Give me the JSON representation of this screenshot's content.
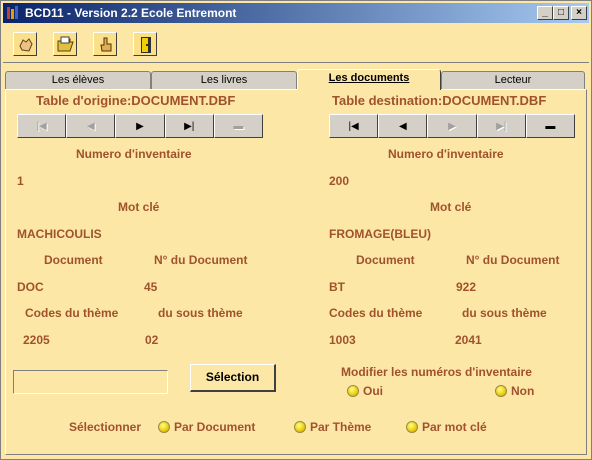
{
  "window": {
    "title": "BCD11 - Version 2.2 Ecole Entremont",
    "min": "_",
    "max": "□",
    "close": "×"
  },
  "toolbar": {
    "icons": [
      "hand-icon",
      "open-folder-icon",
      "hand-pointer-icon",
      "exit-door-icon"
    ]
  },
  "tabs": [
    "Les élèves",
    "Les livres",
    "Les documents",
    "Lecteur"
  ],
  "active_tab": "Les documents",
  "origin": {
    "table_label": "Table d'origine:DOCUMENT.DBF",
    "nav": [
      "|◀",
      "◀",
      "▶",
      "▶|",
      "▬"
    ],
    "numero_label": "Numero d'inventaire",
    "numero": "1",
    "motcle_label": "Mot clé",
    "motcle": "MACHICOULIS",
    "document_label": "Document",
    "ndoc_label": "N° du Document",
    "document": "DOC",
    "ndoc": "45",
    "theme_label": "Codes du thème",
    "soustheme_label": "du sous thème",
    "theme": "2205",
    "soustheme": "02"
  },
  "destination": {
    "table_label": "Table destination:DOCUMENT.DBF",
    "nav": [
      "|◀",
      "◀",
      "▶",
      "▶|",
      "▬"
    ],
    "numero_label": "Numero d'inventaire",
    "numero": "200",
    "motcle_label": "Mot clé",
    "motcle": "FROMAGE(BLEU)",
    "document_label": "Document",
    "ndoc_label": "N° du Document",
    "document": "BT",
    "ndoc": "922",
    "theme_label": "Codes du thème",
    "soustheme_label": "du sous thème",
    "theme": "1003",
    "soustheme": "2041"
  },
  "selection": {
    "input_value": "",
    "button_label": "Sélection"
  },
  "modifier": {
    "label": "Modifier les numéros d'inventaire",
    "oui": "Oui",
    "non": "Non"
  },
  "selectionner": {
    "label": "Sélectionner",
    "options": [
      "Par Document",
      "Par Thème",
      "Par mot clé"
    ]
  },
  "colors": {
    "panel_bg": "#fde7a6",
    "text_accent": "#a0522d",
    "title_gradient_start": "#0a246a"
  }
}
